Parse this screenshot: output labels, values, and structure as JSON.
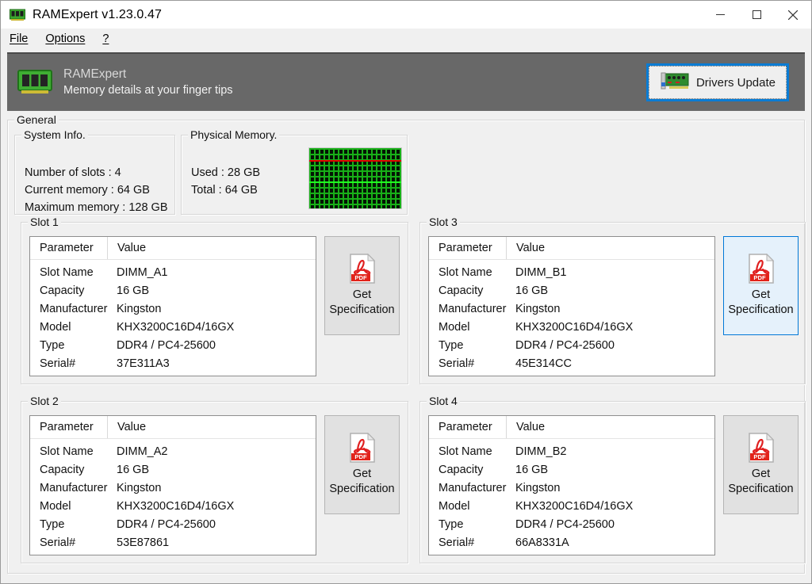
{
  "window": {
    "title": "RAMExpert v1.23.0.47",
    "icon": "ram-module-icon",
    "controls": {
      "minimize": "minimize-icon",
      "maximize": "maximize-icon",
      "close": "close-icon"
    }
  },
  "menu": {
    "items": [
      {
        "label": "File"
      },
      {
        "label": "Options"
      },
      {
        "label": "?"
      }
    ]
  },
  "banner": {
    "icon": "ram-module-icon",
    "title": "RAMExpert",
    "subtitle": "Memory details at your finger tips",
    "drivers_update": {
      "label": "Drivers Update",
      "icon": "expansion-card-icon",
      "focused": true,
      "focus_color": "#0a7cd4"
    }
  },
  "general": {
    "title": "General",
    "system_info": {
      "title": "System Info.",
      "lines": [
        "Number of slots : 4",
        "Current memory : 64 GB",
        "Maximum memory : 128 GB"
      ]
    },
    "physical_memory": {
      "title": "Physical Memory.",
      "lines": [
        "Used : 28 GB",
        "Total : 64 GB"
      ],
      "graph": {
        "grid_color": "#18b018",
        "background_color": "#041504",
        "markers": [
          {
            "name": "used-marker",
            "color": "#e00000",
            "position_percent": 20
          },
          {
            "name": "total-marker",
            "color": "#20ff20",
            "position_percent": 55
          }
        ]
      }
    }
  },
  "slots": [
    {
      "group_title": "Slot 1",
      "columns": [
        "Parameter",
        "Value"
      ],
      "rows": [
        {
          "parameter": "Slot Name",
          "value": "DIMM_A1"
        },
        {
          "parameter": "Capacity",
          "value": "16 GB"
        },
        {
          "parameter": "Manufacturer",
          "value": "Kingston"
        },
        {
          "parameter": "Model",
          "value": "KHX3200C16D4/16GX"
        },
        {
          "parameter": "Type",
          "value": "DDR4 / PC4-25600"
        },
        {
          "parameter": "Serial#",
          "value": "37E311A3"
        }
      ],
      "button": {
        "line1": "Get",
        "line2": "Specification",
        "icon": "pdf-icon",
        "hovered": false
      }
    },
    {
      "group_title": "Slot 3",
      "columns": [
        "Parameter",
        "Value"
      ],
      "rows": [
        {
          "parameter": "Slot Name",
          "value": "DIMM_B1"
        },
        {
          "parameter": "Capacity",
          "value": "16 GB"
        },
        {
          "parameter": "Manufacturer",
          "value": "Kingston"
        },
        {
          "parameter": "Model",
          "value": "KHX3200C16D4/16GX"
        },
        {
          "parameter": "Type",
          "value": "DDR4 / PC4-25600"
        },
        {
          "parameter": "Serial#",
          "value": "45E314CC"
        }
      ],
      "button": {
        "line1": "Get",
        "line2": "Specification",
        "icon": "pdf-icon",
        "hovered": true
      }
    },
    {
      "group_title": "Slot 2",
      "columns": [
        "Parameter",
        "Value"
      ],
      "rows": [
        {
          "parameter": "Slot Name",
          "value": "DIMM_A2"
        },
        {
          "parameter": "Capacity",
          "value": "16 GB"
        },
        {
          "parameter": "Manufacturer",
          "value": "Kingston"
        },
        {
          "parameter": "Model",
          "value": "KHX3200C16D4/16GX"
        },
        {
          "parameter": "Type",
          "value": "DDR4 / PC4-25600"
        },
        {
          "parameter": "Serial#",
          "value": "53E87861"
        }
      ],
      "button": {
        "line1": "Get",
        "line2": "Specification",
        "icon": "pdf-icon",
        "hovered": false
      }
    },
    {
      "group_title": "Slot 4",
      "columns": [
        "Parameter",
        "Value"
      ],
      "rows": [
        {
          "parameter": "Slot Name",
          "value": "DIMM_B2"
        },
        {
          "parameter": "Capacity",
          "value": "16 GB"
        },
        {
          "parameter": "Manufacturer",
          "value": "Kingston"
        },
        {
          "parameter": "Model",
          "value": "KHX3200C16D4/16GX"
        },
        {
          "parameter": "Type",
          "value": "DDR4 / PC4-25600"
        },
        {
          "parameter": "Serial#",
          "value": "66A8331A"
        }
      ],
      "button": {
        "line1": "Get",
        "line2": "Specification",
        "icon": "pdf-icon",
        "hovered": false
      }
    }
  ],
  "pdf_icon_label": "PDF"
}
